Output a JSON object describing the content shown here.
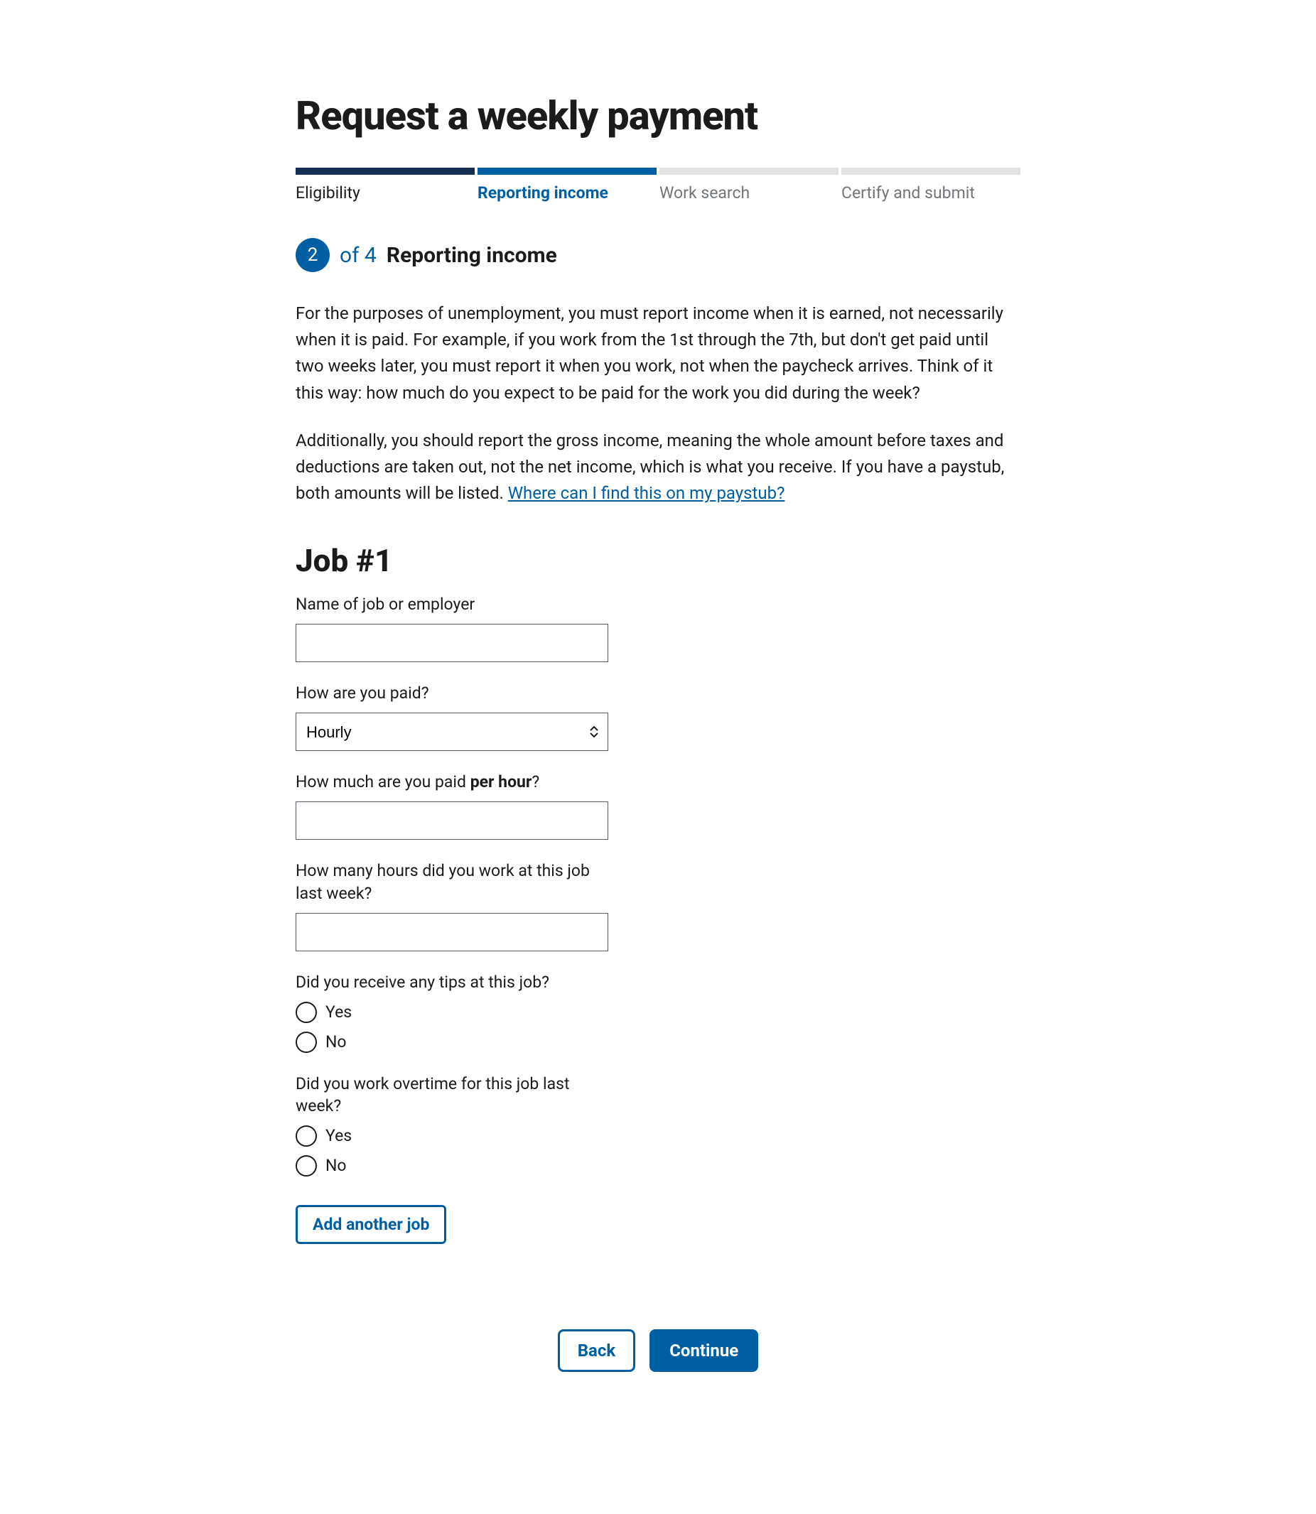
{
  "title": "Request a weekly payment",
  "stepper": {
    "steps": [
      {
        "label": "Eligibility",
        "state": "completed"
      },
      {
        "label": "Reporting income",
        "state": "current"
      },
      {
        "label": "Work search",
        "state": "upcoming"
      },
      {
        "label": "Certify and submit",
        "state": "upcoming"
      }
    ]
  },
  "step_indicator": {
    "current_number": "2",
    "of_text": "of 4",
    "step_name": "Reporting income"
  },
  "intro": {
    "p1": "For the purposes of unemployment, you must report income when it is earned, not necessarily when it is paid. For example, if you work from the 1st through the 7th, but don't get paid until two weeks later, you must report it when you work, not when the paycheck arrives. Think of it this way: how much do you expect to be paid for the work you did during the week?",
    "p2_a": "Additionally, you should report the gross income, meaning the whole amount before taxes and deductions are taken out, not the net income, which is what you receive. If you have a paystub, both amounts will be listed. ",
    "p2_link": "Where can I find this on my paystub?"
  },
  "job": {
    "heading": "Job #1",
    "name_label": "Name of job or employer",
    "name_value": "",
    "pay_type_label": "How are you paid?",
    "pay_type_selected": "Hourly",
    "pay_rate_label_pre": "How much are you paid ",
    "pay_rate_label_bold": "per hour",
    "pay_rate_label_post": "?",
    "pay_rate_value": "",
    "hours_label": "How many hours did you work at this job last week?",
    "hours_value": "",
    "tips_question": "Did you receive any tips at this job?",
    "tips_yes": "Yes",
    "tips_no": "No",
    "overtime_question": "Did you work overtime for this job last week?",
    "overtime_yes": "Yes",
    "overtime_no": "No"
  },
  "add_job_button": "Add another job",
  "nav": {
    "back": "Back",
    "continue": "Continue"
  },
  "colors": {
    "primary": "#005ea2",
    "dark": "#162e51",
    "inactive": "#dfe1e2"
  }
}
